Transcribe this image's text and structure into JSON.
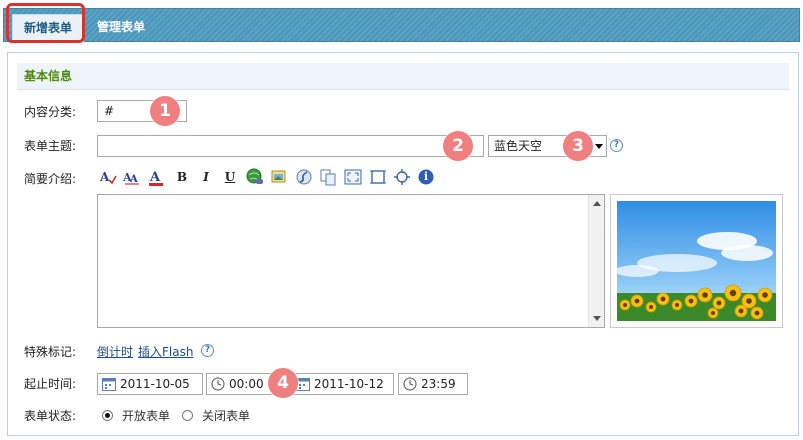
{
  "tabs": [
    {
      "label": "新增表单",
      "active": true
    },
    {
      "label": "管理表单",
      "active": false
    }
  ],
  "section": {
    "title": "基本信息"
  },
  "fields": {
    "category": {
      "label": "内容分类:",
      "value": "#"
    },
    "subject": {
      "label": "表单主题:",
      "value": "",
      "theme_value": "蓝色天空"
    },
    "intro": {
      "label": "简要介绍:"
    },
    "special": {
      "label": "特殊标记:",
      "links": [
        "倒计时",
        "插入Flash"
      ]
    },
    "period": {
      "label": "起止时间:",
      "start_date": "2011-10-05",
      "start_time": "00:00",
      "end_date": "2011-10-12",
      "end_time": "23:59"
    },
    "status": {
      "label": "表单状态:",
      "options": [
        "开放表单",
        "关闭表单"
      ],
      "selected": "开放表单"
    }
  },
  "toolbar_icons": [
    "font-color-icon",
    "spellcheck-icon",
    "text-color-icon",
    "bold-icon",
    "italic-icon",
    "underline-icon",
    "link-globe-icon",
    "image-icon",
    "flash-icon",
    "copy-icon",
    "fullscreen-icon",
    "crop-icon",
    "move-icon",
    "info-icon"
  ],
  "toolbar_glyphs": {
    "bold": "B",
    "italic": "I",
    "underline": "U",
    "info": "i"
  },
  "markers": [
    "1",
    "2",
    "3",
    "4"
  ],
  "help_glyph": "?",
  "colors": {
    "tab_bar": "#4a95b9",
    "section_title": "#4f8a10",
    "marker": "#f08080",
    "highlight_border": "#d8322f",
    "link": "#1a4e8a"
  }
}
